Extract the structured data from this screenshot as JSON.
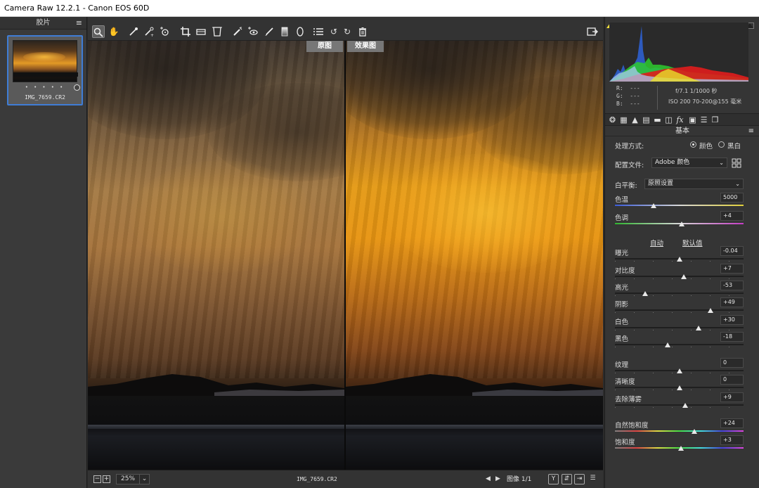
{
  "window": {
    "title": "Camera Raw 12.2.1 -  Canon EOS 60D"
  },
  "filmstrip": {
    "header": "胶片",
    "thumbnail": {
      "filename": "IMG_7659.CR2",
      "rating": "• • • • •"
    }
  },
  "toolbar": {
    "tools": [
      "zoom-tool",
      "hand-tool",
      "white-balance-tool",
      "color-sampler-tool",
      "targeted-adjustment-tool",
      "crop-tool",
      "straighten-tool",
      "transform-tool",
      "spot-removal-tool",
      "red-eye-tool",
      "adjustment-brush-tool",
      "graduated-filter-tool",
      "radial-filter-tool",
      "presets-list",
      "rotate-left",
      "rotate-right",
      "delete"
    ]
  },
  "preview": {
    "before_label": "原图",
    "after_label": "效果图"
  },
  "statusbar": {
    "zoom": "25%",
    "filename": "IMG_7659.CR2",
    "image_count": "图像 1/1"
  },
  "histogram_meta": {
    "r_label": "R:",
    "g_label": "G:",
    "b_label": "B:",
    "r_value": "---",
    "g_value": "---",
    "b_value": "---",
    "exif_line1": "f/7.1   1/1000 秒",
    "exif_line2": "ISO 200   70-200@155 毫米"
  },
  "basic_panel": {
    "title": "基本",
    "treatment": {
      "label": "处理方式:",
      "option_color": "颜色",
      "option_bw": "黑白",
      "selected": "color"
    },
    "profile": {
      "label": "配置文件:",
      "value": "Adobe 颜色"
    },
    "white_balance": {
      "label": "白平衡:",
      "value": "原照设置"
    },
    "auto_label": "自动",
    "default_label": "默认值",
    "sliders": [
      {
        "id": "temperature",
        "label": "色温",
        "value": "5000",
        "position": 0.3
      },
      {
        "id": "tint",
        "label": "色调",
        "value": "+4",
        "position": 0.52
      },
      {
        "id": "exposure",
        "label": "曝光",
        "value": "-0.04",
        "position": 0.5
      },
      {
        "id": "contrast",
        "label": "对比度",
        "value": "+7",
        "position": 0.535
      },
      {
        "id": "highlights",
        "label": "高光",
        "value": "-53",
        "position": 0.235
      },
      {
        "id": "shadows",
        "label": "阴影",
        "value": "+49",
        "position": 0.745
      },
      {
        "id": "whites",
        "label": "白色",
        "value": "+30",
        "position": 0.65
      },
      {
        "id": "blacks",
        "label": "黑色",
        "value": "-18",
        "position": 0.41
      },
      {
        "id": "texture",
        "label": "纹理",
        "value": "0",
        "position": 0.5
      },
      {
        "id": "clarity",
        "label": "清晰度",
        "value": "0",
        "position": 0.5
      },
      {
        "id": "dehaze",
        "label": "去除薄雾",
        "value": "+9",
        "position": 0.545
      },
      {
        "id": "vibrance",
        "label": "自然饱和度",
        "value": "+24",
        "position": 0.62
      },
      {
        "id": "saturation",
        "label": "饱和度",
        "value": "+3",
        "position": 0.515
      }
    ]
  },
  "colors": {
    "accent": "#3f7dd6",
    "panel_bg": "#353535",
    "toolbar_bg": "#333333"
  }
}
